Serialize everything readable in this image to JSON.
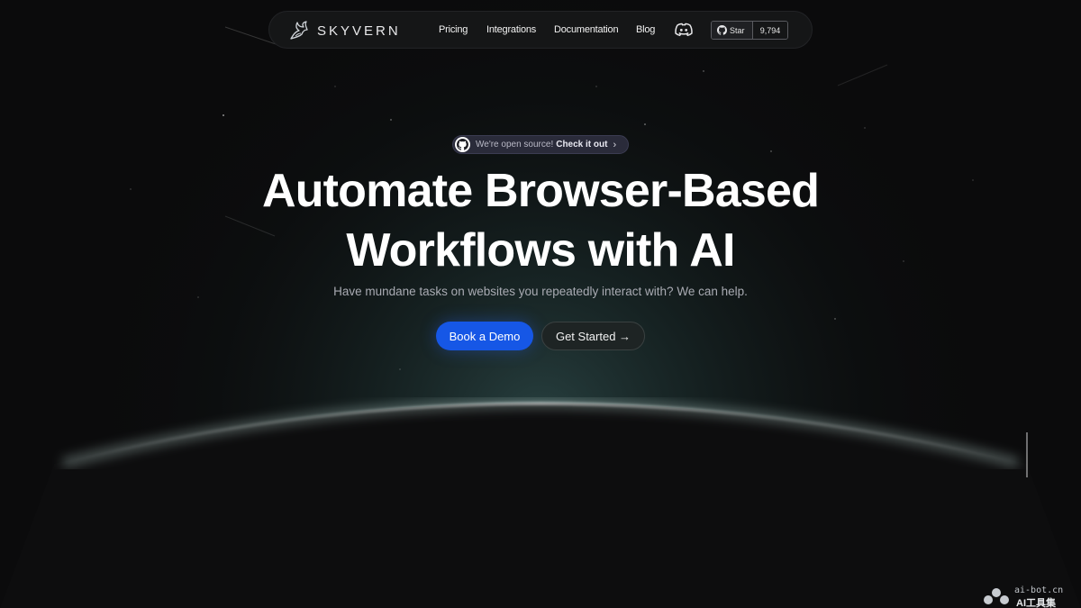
{
  "brand": {
    "name": "SKYVERN",
    "accent": "#1657e6"
  },
  "nav": {
    "links": [
      {
        "label": "Pricing"
      },
      {
        "label": "Integrations"
      },
      {
        "label": "Documentation"
      },
      {
        "label": "Blog"
      }
    ],
    "discord_icon": "discord-icon",
    "github": {
      "label": "Star",
      "count": "9,794"
    }
  },
  "badge": {
    "text": "We're open source!",
    "link": "Check it out",
    "chevron": "›"
  },
  "hero": {
    "title_line1": "Automate Browser-Based",
    "title_line2": "Workflows with AI",
    "subtitle": "Have mundane tasks on websites you repeatedly interact with? We can help."
  },
  "cta": {
    "primary": "Book a Demo",
    "secondary": "Get Started →"
  },
  "watermark": {
    "top": "ai-bot.cn",
    "bottom": "AI工具集"
  }
}
